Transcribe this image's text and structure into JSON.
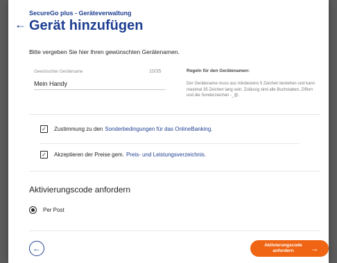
{
  "header": {
    "breadcrumb": "SecureGo plus - Geräteverwaltung",
    "back_icon": "arrow-left-icon",
    "title": "Gerät hinzufügen"
  },
  "intro": "Bitte vergeben Sie hier Ihren gewünschten Gerätenamen.",
  "device_name_field": {
    "label": "Gewünschter Gerätename",
    "counter": "10/35",
    "value": "Mein Handy"
  },
  "rules": {
    "title": "Regeln für den Gerätenamen:",
    "text": "Der Gerätename muss aus mindestens 5 Zeichen bestehen und kann maximal 35 Zeichen lang sein. Zulässig sind alle Buchstaben, Ziffern und die Sonderzeichen -_@."
  },
  "consents": [
    {
      "checked": true,
      "text": "Zustimmung zu den",
      "link": "Sonderbedingungen für das OnlineBanking."
    },
    {
      "checked": true,
      "text": "Akzeptieren der Preise gem.",
      "link": "Preis- und Leistungsverzeichnis."
    }
  ],
  "activation": {
    "title": "Aktivierungscode anfordern",
    "options": [
      {
        "label": "Per Post",
        "selected": true
      }
    ]
  },
  "footer": {
    "back_icon": "circle-arrow-left-icon",
    "primary_label": "Aktivierungscode anfordern",
    "primary_icon": "arrow-right-icon"
  },
  "colors": {
    "brand_blue": "#1e3f91",
    "accent_orange": "#f06514",
    "backdrop": "#5c5c5c"
  }
}
